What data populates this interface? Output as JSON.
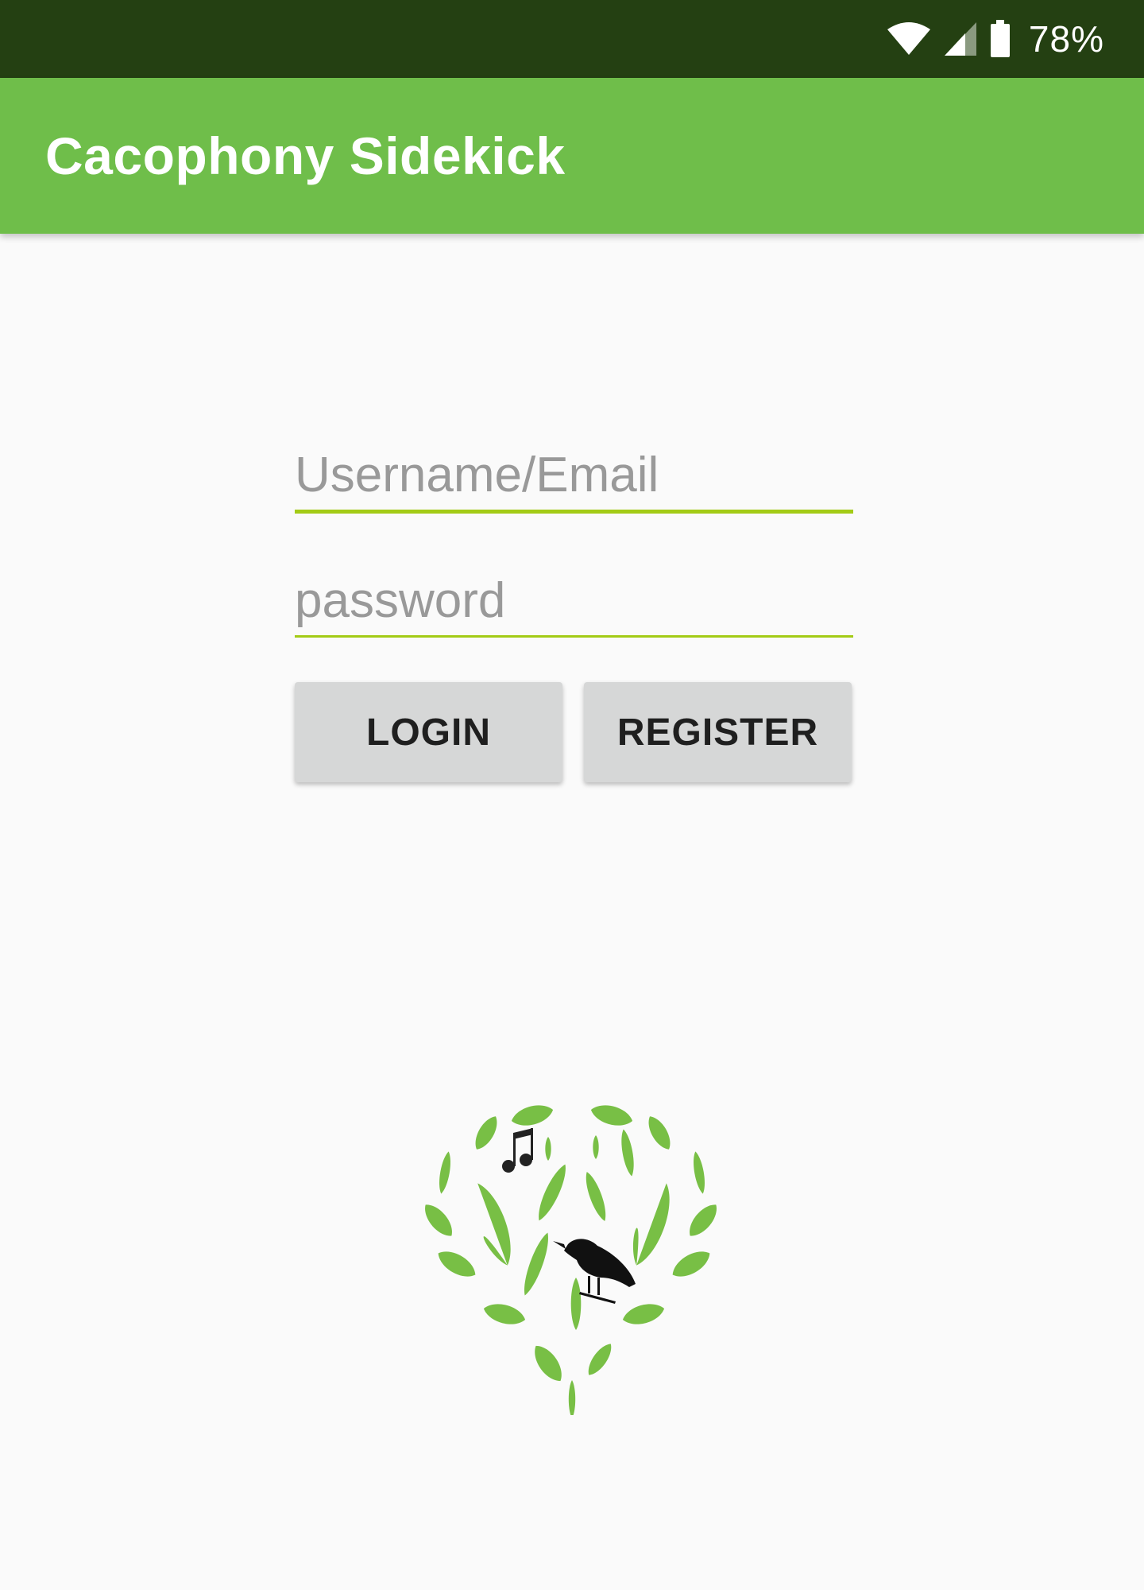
{
  "status_bar": {
    "battery_percent": "78%",
    "icons": [
      "wifi-icon",
      "cellular-signal-icon",
      "battery-icon"
    ]
  },
  "app_bar": {
    "title": "Cacophony Sidekick"
  },
  "login_form": {
    "username_placeholder": "Username/Email",
    "username_value": "",
    "password_placeholder": "password",
    "password_value": "",
    "login_label": "LOGIN",
    "register_label": "REGISTER"
  },
  "logo": {
    "icon": "cacophony-heart-leaves-bird-logo"
  },
  "colors": {
    "status_bar": "#244012",
    "app_bar": "#6fbe4a",
    "accent": "#a3cb16",
    "button": "#d6d7d7",
    "background": "#fafafa"
  }
}
